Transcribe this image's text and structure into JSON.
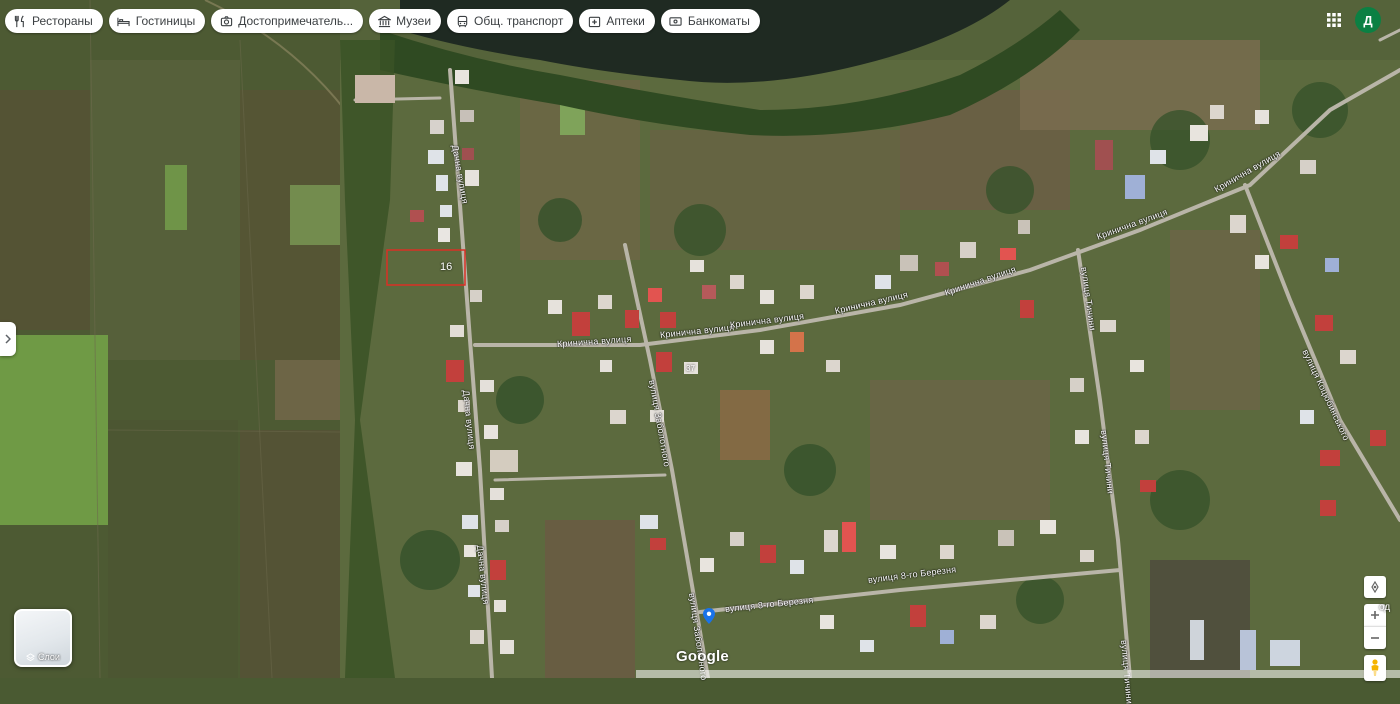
{
  "chips": [
    {
      "label": "Рестораны",
      "icon": "restaurant-icon"
    },
    {
      "label": "Гостиницы",
      "icon": "bed-icon"
    },
    {
      "label": "Достопримечатель...",
      "icon": "camera-icon"
    },
    {
      "label": "Музеи",
      "icon": "museum-icon"
    },
    {
      "label": "Общ. транспорт",
      "icon": "bus-icon"
    },
    {
      "label": "Аптеки",
      "icon": "pharmacy-icon"
    },
    {
      "label": "Банкоматы",
      "icon": "atm-icon"
    }
  ],
  "account": {
    "initial": "Д",
    "color": "#0b8043"
  },
  "layers": {
    "label": "Слои"
  },
  "logo": {
    "text": "Google"
  },
  "right_edge_text": "од",
  "plot": {
    "number": "16",
    "outline_color": "#d93025"
  },
  "house_numbers": {
    "a": "37"
  },
  "streets": {
    "krynychna_1": "Кринична вулиця",
    "krynychna_2": "Кринична вулиця",
    "krynychna_3": "Кринична вулиця",
    "krynychna_4": "Кринична вулиця",
    "krynychna_5": "Кринична вулиця",
    "krynychna_6": "Кринична вулиця",
    "krynychna_7": "Кринична вулиця",
    "dachna_1": "Дачна вулиця",
    "dachna_2": "Дачна вулиця",
    "dachna_3": "Дачна вулиця",
    "zaboloty_1": "вулиця Заболотного",
    "zaboloty_2": "вулиця Заболотного",
    "berezhnia_1": "вулиця 8-го Березня",
    "berezhnia_2": "вулиця 8-го Березня",
    "tychyna_1": "вулиця Тичини",
    "tychyna_2": "вулиця Тичини",
    "tychyna_3": "вулиця Тичини",
    "kotsiub_1": "вулиця Коцюбинського"
  },
  "colors": {
    "water": "#1f2a22",
    "field": "#5a6e3a",
    "road": "#b9b5a8",
    "marker": "#1a73e8"
  }
}
